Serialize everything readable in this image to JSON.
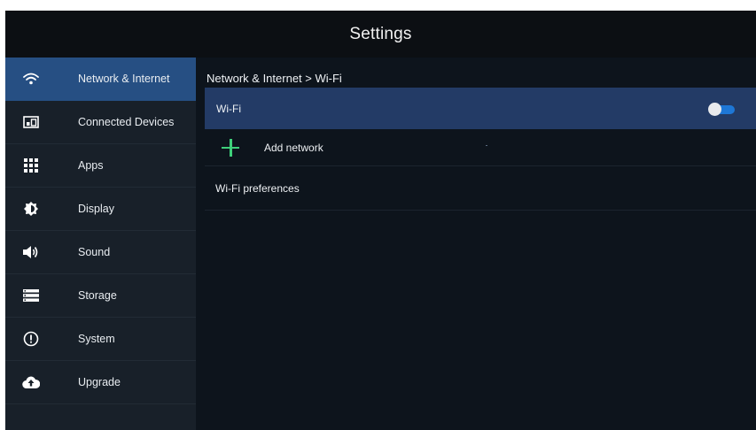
{
  "header": {
    "title": "Settings"
  },
  "sidebar": {
    "items": [
      {
        "label": "Network & Internet",
        "icon": "wifi-icon",
        "active": true
      },
      {
        "label": "Connected Devices",
        "icon": "connected-devices-icon",
        "active": false
      },
      {
        "label": "Apps",
        "icon": "apps-grid-icon",
        "active": false
      },
      {
        "label": "Display",
        "icon": "brightness-icon",
        "active": false
      },
      {
        "label": "Sound",
        "icon": "speaker-icon",
        "active": false
      },
      {
        "label": "Storage",
        "icon": "storage-icon",
        "active": false
      },
      {
        "label": "System",
        "icon": "info-alert-icon",
        "active": false
      },
      {
        "label": "Upgrade",
        "icon": "cloud-upload-icon",
        "active": false
      }
    ]
  },
  "main": {
    "breadcrumb": "Network & Internet > Wi-Fi",
    "wifi": {
      "label": "Wi-Fi",
      "toggle_on": true
    },
    "add_network": {
      "label": "Add network",
      "icon": "plus-icon"
    },
    "wifi_preferences": {
      "label": "Wi-Fi preferences"
    }
  },
  "colors": {
    "background": "#0d141c",
    "sidebar": "#182029",
    "sidebar_active": "#264f83",
    "wifi_row": "#233b66",
    "toggle_track": "#1e77d6",
    "plus_accent": "#3ed07a"
  }
}
